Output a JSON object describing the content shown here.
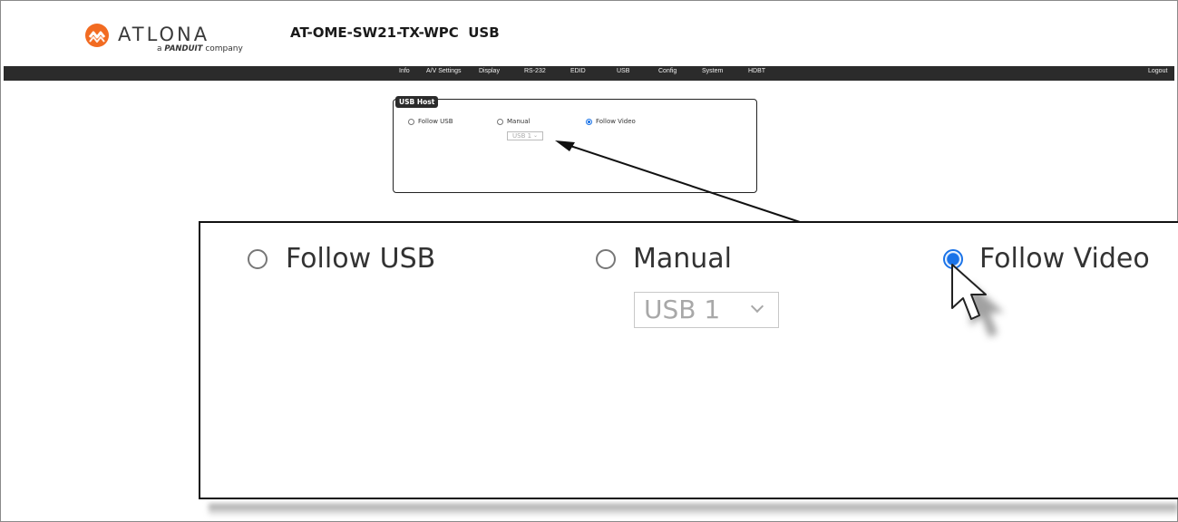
{
  "header": {
    "logo_text": "ATLONA",
    "logo_sub_brand": "PANDUIT",
    "logo_sub_suffix": "company",
    "logo_sub_prefix": "a",
    "product_title": "AT-OME-SW21-TX-WPC  USB"
  },
  "nav": {
    "items": [
      "Info",
      "A/V Settings",
      "Display",
      "RS-232",
      "EDID",
      "USB",
      "Config",
      "System",
      "HDBT"
    ],
    "logout": "Logout"
  },
  "usb_host": {
    "legend": "USB Host",
    "options": {
      "follow_usb": "Follow USB",
      "manual": "Manual",
      "follow_video": "Follow Video"
    },
    "selected": "Follow Video",
    "manual_select_value": "USB 1"
  },
  "colors": {
    "nav_bg": "#2b2b2b",
    "accent_blue": "#1a73e8",
    "logo_orange": "#f26b21"
  },
  "icons": {
    "logo": "atlona-logo-icon",
    "cursor": "mouse-pointer-icon",
    "dropdown": "chevron-down-icon"
  }
}
